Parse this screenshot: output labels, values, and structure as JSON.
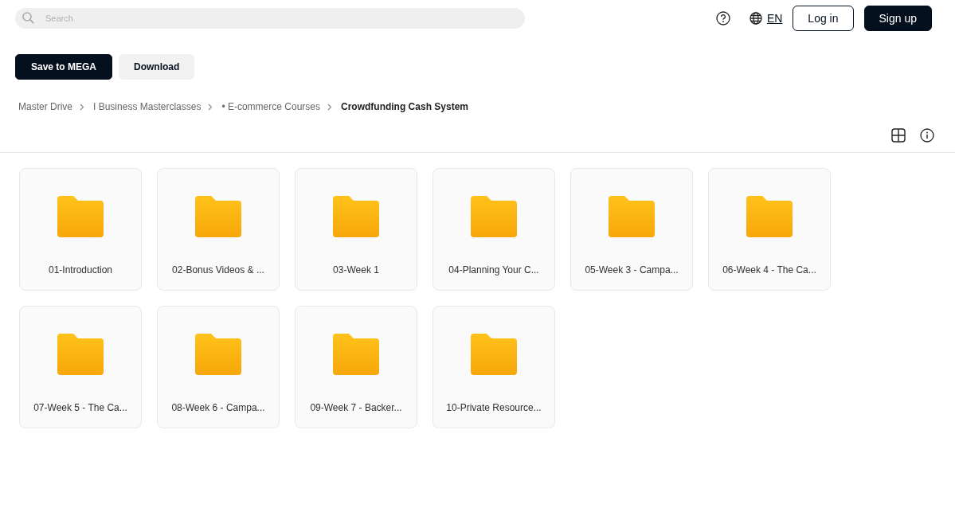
{
  "search": {
    "placeholder": "Search"
  },
  "header": {
    "language": "EN",
    "buttons": [
      {
        "label": "Log in",
        "kind": "outline"
      },
      {
        "label": "Sign up",
        "kind": "primary"
      }
    ]
  },
  "actions": [
    {
      "label": "Save to MEGA",
      "kind": "primary"
    },
    {
      "label": "Download",
      "kind": "secondary"
    }
  ],
  "breadcrumbs": [
    {
      "label": "Master Drive",
      "current": false
    },
    {
      "label": "I Business Masterclasses",
      "current": false
    },
    {
      "label": "• E-commerce Courses",
      "current": false
    },
    {
      "label": "Crowdfunding Cash System",
      "current": true
    }
  ],
  "folders": [
    {
      "name": "01-Introduction"
    },
    {
      "name": "02-Bonus Videos & ..."
    },
    {
      "name": "03-Week 1"
    },
    {
      "name": "04-Planning Your C..."
    },
    {
      "name": "05-Week 3 - Campa..."
    },
    {
      "name": "06-Week 4 - The Ca..."
    },
    {
      "name": "07-Week 5 - The Ca..."
    },
    {
      "name": "08-Week 6 - Campa..."
    },
    {
      "name": "09-Week 7 - Backer..."
    },
    {
      "name": "10-Private Resource..."
    }
  ]
}
